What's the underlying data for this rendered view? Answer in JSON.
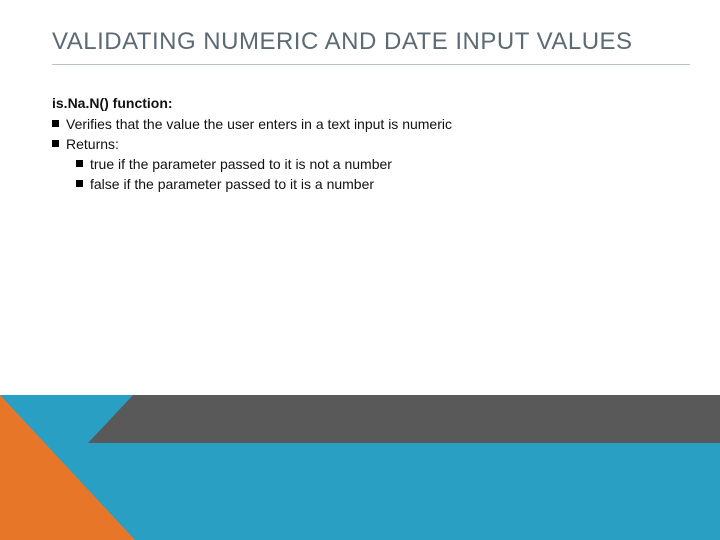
{
  "title": "VALIDATING NUMERIC AND DATE INPUT VALUES",
  "lead": "is.Na.N() function:",
  "bullets": {
    "b1": "Verifies that the value the user enters in a text input is numeric",
    "b2": "Returns:",
    "b2a": "true if the parameter passed to it is not a number",
    "b2b": "false if the parameter passed to it is a number"
  }
}
